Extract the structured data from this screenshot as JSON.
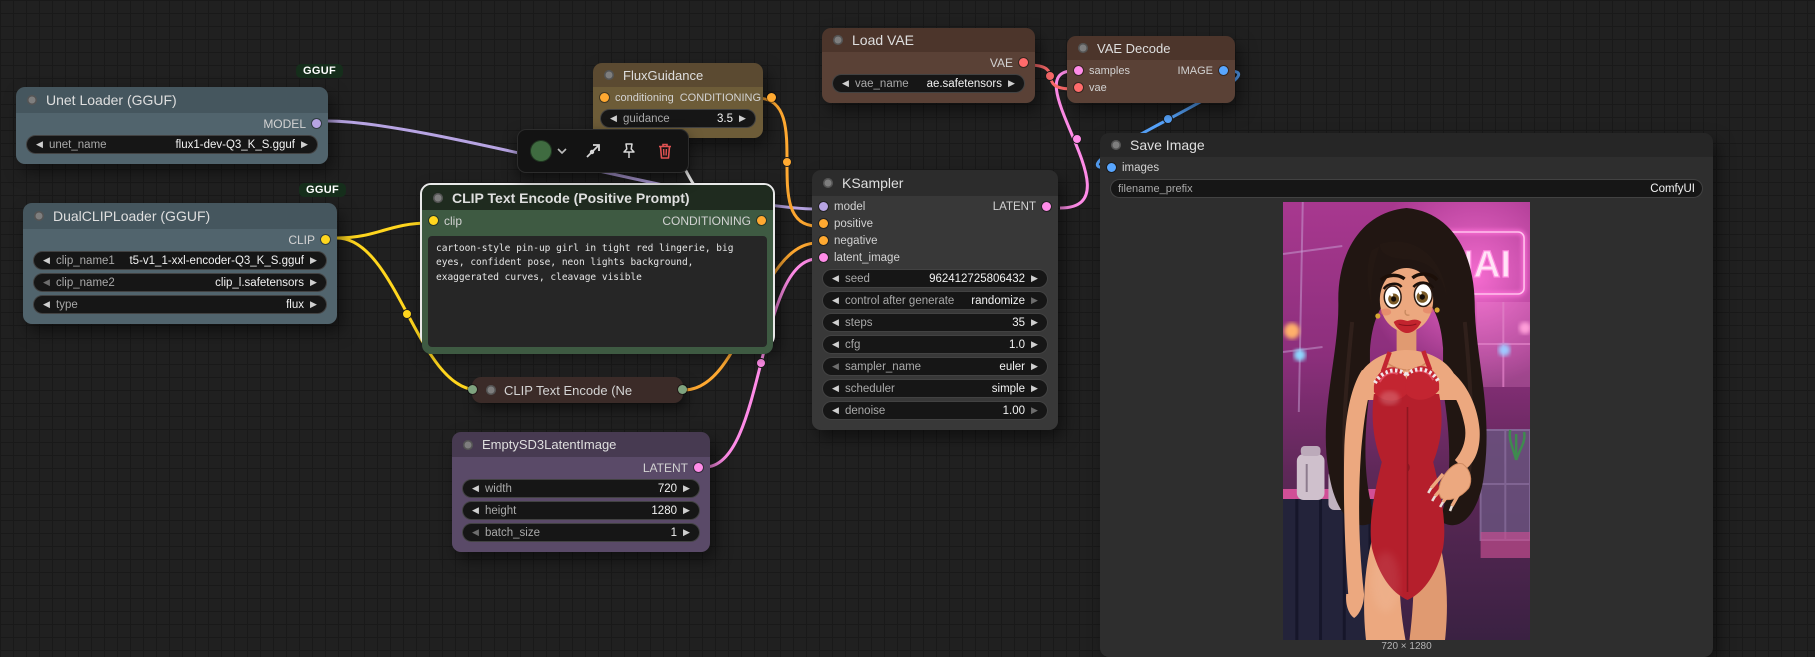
{
  "badge_label": "GGUF",
  "nodes": {
    "unet_loader": {
      "title": "Unet Loader (GGUF)",
      "output": "MODEL",
      "widgets": [
        {
          "label": "unet_name",
          "value": "flux1-dev-Q3_K_S.gguf"
        }
      ]
    },
    "dual_clip_loader": {
      "title": "DualCLIPLoader (GGUF)",
      "output": "CLIP",
      "widgets": [
        {
          "label": "clip_name1",
          "value": "t5-v1_1-xxl-encoder-Q3_K_S.gguf"
        },
        {
          "label": "clip_name2",
          "value": "clip_l.safetensors"
        },
        {
          "label": "type",
          "value": "flux"
        }
      ]
    },
    "flux_guidance": {
      "title": "FluxGuidance",
      "input": "conditioning",
      "output": "CONDITIONING",
      "widgets": [
        {
          "label": "guidance",
          "value": "3.5"
        }
      ]
    },
    "load_vae": {
      "title": "Load VAE",
      "output": "VAE",
      "widgets": [
        {
          "label": "vae_name",
          "value": "ae.safetensors"
        }
      ]
    },
    "vae_decode": {
      "title": "VAE Decode",
      "inputs": [
        "samples",
        "vae"
      ],
      "output": "IMAGE"
    },
    "clip_text_positive": {
      "title": "CLIP Text Encode (Positive Prompt)",
      "input": "clip",
      "output": "CONDITIONING",
      "prompt": "cartoon-style pin-up girl in tight red lingerie, big eyes, confident pose, neon lights background, exaggerated curves, cleavage visible"
    },
    "clip_text_negative": {
      "title": "CLIP Text Encode (Ne"
    },
    "empty_latent": {
      "title": "EmptySD3LatentImage",
      "output": "LATENT",
      "widgets": [
        {
          "label": "width",
          "value": "720"
        },
        {
          "label": "height",
          "value": "1280"
        },
        {
          "label": "batch_size",
          "value": "1"
        }
      ]
    },
    "ksampler": {
      "title": "KSampler",
      "inputs": [
        "model",
        "positive",
        "negative",
        "latent_image"
      ],
      "output": "LATENT",
      "widgets": [
        {
          "label": "seed",
          "value": "962412725806432"
        },
        {
          "label": "control after generate",
          "value": "randomize"
        },
        {
          "label": "steps",
          "value": "35"
        },
        {
          "label": "cfg",
          "value": "1.0"
        },
        {
          "label": "sampler_name",
          "value": "euler"
        },
        {
          "label": "scheduler",
          "value": "simple"
        },
        {
          "label": "denoise",
          "value": "1.00"
        }
      ]
    },
    "save_image": {
      "title": "Save Image",
      "input": "images",
      "widgets": [
        {
          "label": "filename_prefix",
          "value": "ComfyUI"
        }
      ],
      "image_caption": "720 × 1280"
    }
  },
  "colors": {
    "model": "#b7a4e3",
    "clip": "#ffd61e",
    "conditioning": "#ffa931",
    "vae": "#ff6b6b",
    "latent": "#ff8ce8",
    "image": "#58a6ff"
  }
}
